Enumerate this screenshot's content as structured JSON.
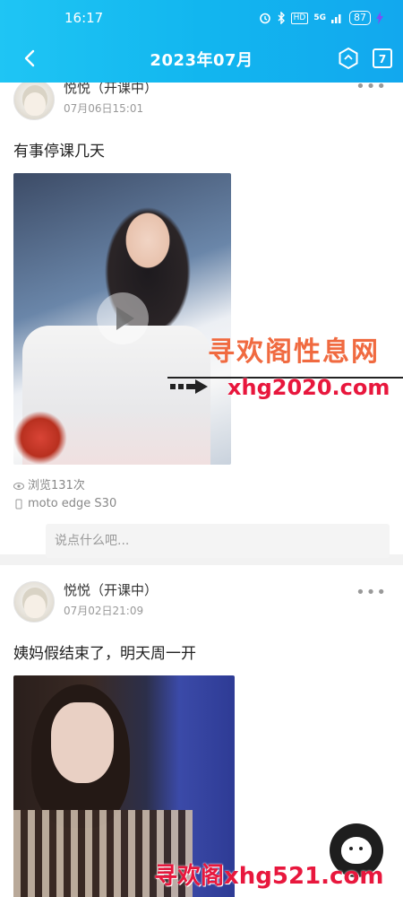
{
  "status_bar": {
    "time": "16:17",
    "icons": [
      "alarm-icon",
      "bluetooth-icon",
      "hd-icon",
      "5g-signal-icon",
      "battery-icon",
      "charging-icon"
    ],
    "hd_label": "HD",
    "network_label": "5G",
    "battery_level": "87"
  },
  "header": {
    "title": "2023年07月",
    "back_icon": "back-arrow-icon",
    "right_icons": [
      "hexagon-icon",
      "calendar-icon"
    ],
    "calendar_day": "7",
    "accent_start": "#1fc5f4",
    "accent_end": "#12a8ee"
  },
  "posts": [
    {
      "author_name": "悦悦（开课中）",
      "time": "07月06日15:01",
      "text": "有事停课几天",
      "media": "video",
      "views": "浏览131次",
      "device": "moto edge S30",
      "comment_placeholder": "说点什么吧..."
    },
    {
      "author_name": "悦悦（开课中）",
      "time": "07月02日21:09",
      "text": "姨妈假结束了，明天周一开",
      "media": "image"
    }
  ],
  "more_label": "•••",
  "watermarks": {
    "site_name": "寻欢阁性息网",
    "site_url": "xhg2020.com",
    "footer": "寻欢阁xhg521.com"
  }
}
